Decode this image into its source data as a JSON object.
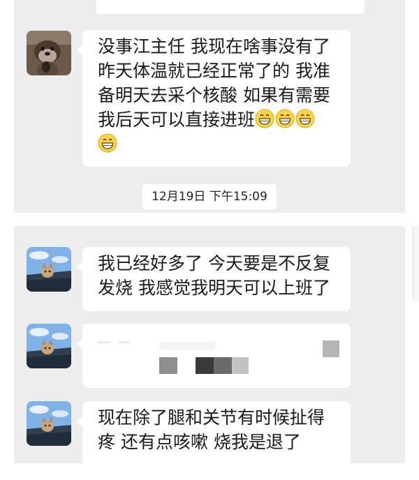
{
  "chat": {
    "messages": [
      {
        "sender": "otter-contact",
        "lines": [
          "没事江主任 我现在啥事没有了",
          "昨天体温就已经正常了的 我准",
          "备明天去采个核酸 如果有需要",
          "我后天可以直接进班"
        ],
        "emoji": "grinning-face-icon"
      },
      {
        "sender": "cat-contact",
        "lines": [
          "我已经好多了 今天要是不反复",
          "发烧 我感觉我明天可以上班了"
        ]
      },
      {
        "sender": "cat-contact",
        "redacted": true
      },
      {
        "sender": "cat-contact",
        "lines": [
          "现在除了腿和关节有时候扯得",
          "疼 还有点咳嗽 烧我是退了"
        ]
      }
    ],
    "timestamp": "12月19日 下午15:09"
  },
  "colors": {
    "panel_bg": "#ededed",
    "bubble_bg": "#ffffff",
    "emoji_face": "#fcd34d"
  }
}
